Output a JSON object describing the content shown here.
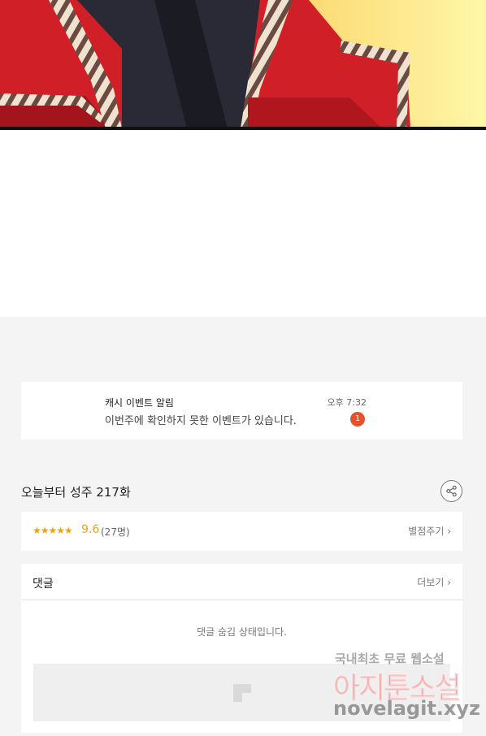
{
  "notice": {
    "title": "캐시 이벤트 알림",
    "message": "이번주에 확인하지 못한 이벤트가 있습니다.",
    "time": "오후 7:32",
    "badge": "1"
  },
  "episode": {
    "title": "오늘부터 성주 217화",
    "share_icon": "share-icon"
  },
  "rating": {
    "stars": "★★★★★",
    "score": "9.6",
    "count": "(27명)",
    "rate_link": "별점주기 ›"
  },
  "comments": {
    "title": "댓글",
    "more_link": "더보기 ›",
    "hidden_message": "댓글 숨김 상태입니다."
  },
  "watermark": {
    "line1": "국내최초 무료 웹소설",
    "line2": "아지툰소설",
    "line3": "novelagit.xyz"
  },
  "colors": {
    "accent_star": "#e8a31c",
    "badge": "#e2532b",
    "background": "#f4f4f4"
  }
}
